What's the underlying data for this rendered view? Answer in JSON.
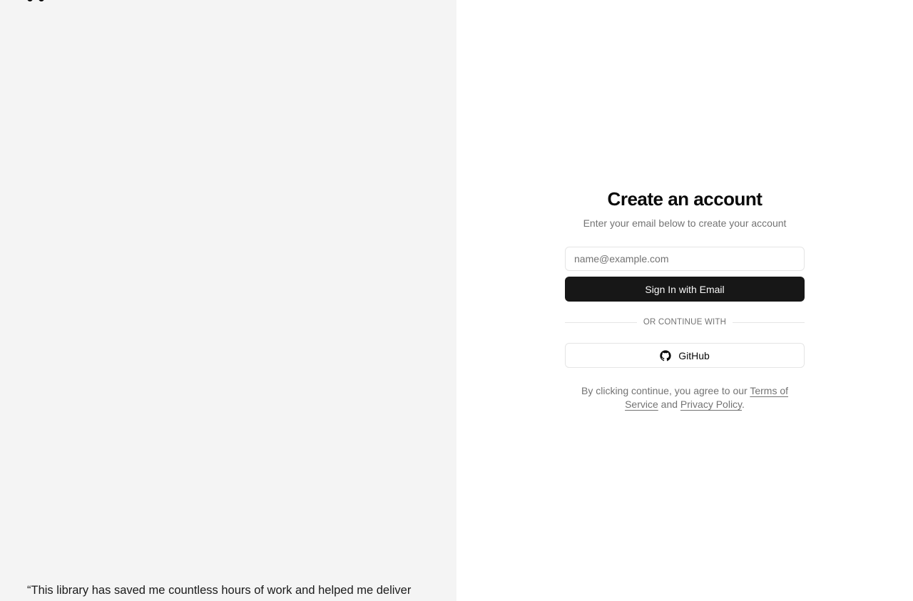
{
  "left_panel": {
    "logo_icon": "command-icon",
    "testimonial_text": "“This library has saved me countless hours of work and helped me deliver"
  },
  "auth": {
    "title": "Create an account",
    "subtitle": "Enter your email below to create your account",
    "email_placeholder": "name@example.com",
    "email_value": "",
    "sign_in_label": "Sign In with Email",
    "divider_label": "Or continue with",
    "github_label": "GitHub",
    "github_icon": "github-icon",
    "terms": {
      "prefix": "By clicking continue, you agree to our ",
      "terms_link": "Terms of Service",
      "middle": " and ",
      "privacy_link": "Privacy Policy",
      "suffix": "."
    }
  },
  "colors": {
    "left_background": "#f4f4f4",
    "primary_button": "#171717",
    "muted_text": "#737373",
    "border": "#e5e5e5"
  }
}
